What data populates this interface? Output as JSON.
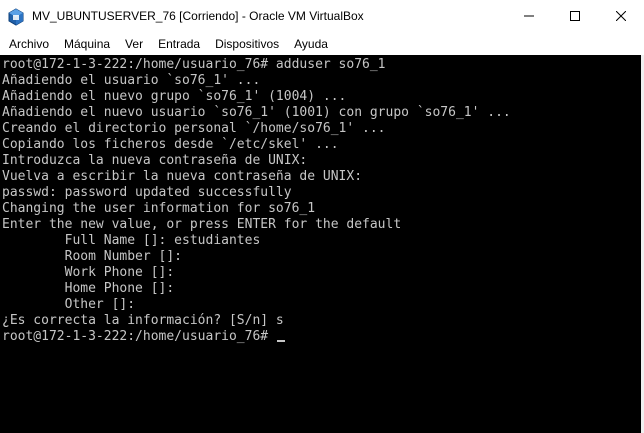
{
  "window": {
    "title": "MV_UBUNTUSERVER_76 [Corriendo] - Oracle VM VirtualBox",
    "icon": "virtualbox-icon",
    "controls": [
      "minimize-icon",
      "maximize-icon",
      "close-icon"
    ]
  },
  "menu": {
    "items": [
      {
        "label": "Archivo"
      },
      {
        "label": "Máquina"
      },
      {
        "label": "Ver"
      },
      {
        "label": "Entrada"
      },
      {
        "label": "Dispositivos"
      },
      {
        "label": "Ayuda"
      }
    ]
  },
  "terminal": {
    "lines": [
      "root@172-1-3-222:/home/usuario_76# adduser so76_1",
      "Añadiendo el usuario `so76_1' ...",
      "Añadiendo el nuevo grupo `so76_1' (1004) ...",
      "Añadiendo el nuevo usuario `so76_1' (1001) con grupo `so76_1' ...",
      "Creando el directorio personal `/home/so76_1' ...",
      "Copiando los ficheros desde `/etc/skel' ...",
      "Introduzca la nueva contraseña de UNIX:",
      "Vuelva a escribir la nueva contraseña de UNIX:",
      "passwd: password updated successfully",
      "Changing the user information for so76_1",
      "Enter the new value, or press ENTER for the default",
      "        Full Name []: estudiantes",
      "        Room Number []:",
      "        Work Phone []:",
      "        Home Phone []:",
      "        Other []:",
      "¿Es correcta la información? [S/n] s",
      "root@172-1-3-222:/home/usuario_76# "
    ],
    "background": "#000000",
    "foreground": "#c6c6c6"
  }
}
